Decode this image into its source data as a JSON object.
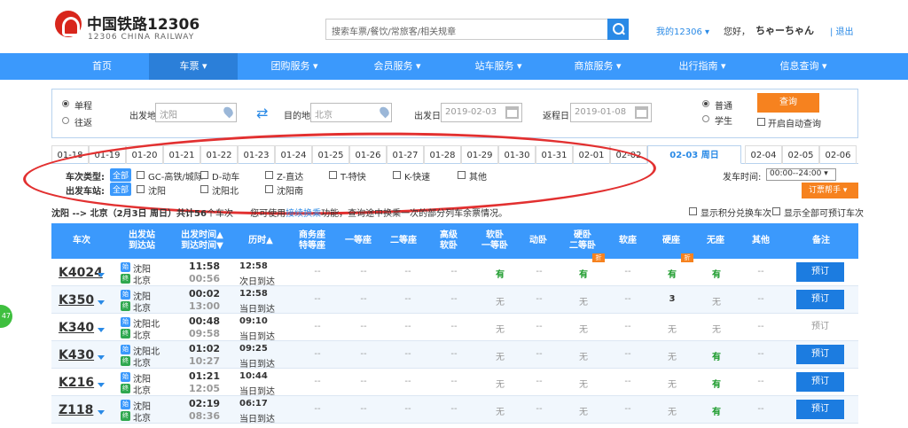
{
  "brand": {
    "cn": "中国铁路12306",
    "en": "12306 CHINA RAILWAY"
  },
  "search": {
    "placeholder": "搜索车票/餐饮/常旅客/相关规章"
  },
  "user": {
    "my": "我的12306 ▾",
    "hello": "您好，",
    "name": "ちゃーちゃん",
    "logout": "| 退出"
  },
  "nav": [
    "首页",
    "车票 ▾",
    "团购服务 ▾",
    "会员服务 ▾",
    "站车服务 ▾",
    "商旅服务 ▾",
    "出行指南 ▾",
    "信息查询 ▾"
  ],
  "query": {
    "oneway": "单程",
    "round": "往返",
    "from_label": "出发地",
    "from_value": "沈阳",
    "to_label": "目的地",
    "to_value": "北京",
    "date_label": "出发日",
    "date_value": "2019-02-03",
    "return_label": "返程日",
    "return_value": "2019-01-08",
    "normal": "普通",
    "student": "学生",
    "query_btn": "查询",
    "auto_query": "开启自动查询"
  },
  "dates": [
    "01-18",
    "01-19",
    "01-20",
    "01-21",
    "01-22",
    "01-23",
    "01-24",
    "01-25",
    "01-26",
    "01-27",
    "01-28",
    "01-29",
    "01-30",
    "01-31",
    "02-01",
    "02-02",
    "02-03 周日",
    "02-04",
    "02-05",
    "02-06"
  ],
  "filters": {
    "type_label": "车次类型:",
    "all": "全部",
    "types": [
      "GC-高铁/城际",
      "D-动车",
      "Z-直达",
      "T-特快",
      "K-快速",
      "其他"
    ],
    "station_label": "出发车站:",
    "stations": [
      "沈阳",
      "沈阳北",
      "沈阳南"
    ],
    "depart_time_label": "发车时间:",
    "depart_time": "00:00--24:00",
    "helper": "订票帮手 ▾"
  },
  "summary": {
    "route": "沈阳 --> 北京（2月3日 周日）共计",
    "count": "56",
    "tail": "个车次",
    "hint_a": "您可使用",
    "hint_link": "接续换乘",
    "hint_b": "功能，查询途中换乘一次的部分列车余票情况。",
    "opt1": "显示积分兑换车次",
    "opt2": "显示全部可预订车次"
  },
  "headers": [
    "车次",
    "出发站\n到达站",
    "出发时间▲\n到达时间▼",
    "历时▲",
    "商务座\n特等座",
    "一等座",
    "二等座",
    "高级\n软卧",
    "软卧\n一等卧",
    "动卧",
    "硬卧\n二等卧",
    "软座",
    "硬座",
    "无座",
    "其他",
    "备注"
  ],
  "trains": [
    {
      "no": "K4024",
      "from": "沈阳",
      "to": "北京",
      "dep": "11:58",
      "arr": "00:56",
      "dur": "12:58",
      "arrday": "次日到达",
      "seats": [
        "--",
        "--",
        "--",
        "--",
        "有",
        "--",
        "有",
        "--",
        "有",
        "有",
        "--"
      ],
      "book": "预订"
    },
    {
      "no": "K350",
      "from": "沈阳",
      "to": "北京",
      "dep": "00:02",
      "arr": "13:00",
      "dur": "12:58",
      "arrday": "当日到达",
      "seats": [
        "--",
        "--",
        "--",
        "--",
        "无",
        "--",
        "无",
        "--",
        "3",
        "无",
        "--"
      ],
      "book": "预订"
    },
    {
      "no": "K340",
      "from": "沈阳北",
      "to": "北京",
      "dep": "00:48",
      "arr": "09:58",
      "dur": "09:10",
      "arrday": "当日到达",
      "seats": [
        "--",
        "--",
        "--",
        "--",
        "无",
        "--",
        "无",
        "--",
        "无",
        "无",
        "--"
      ],
      "book": "预订"
    },
    {
      "no": "K430",
      "from": "沈阳北",
      "to": "北京",
      "dep": "01:02",
      "arr": "10:27",
      "dur": "09:25",
      "arrday": "当日到达",
      "seats": [
        "--",
        "--",
        "--",
        "--",
        "无",
        "--",
        "无",
        "--",
        "无",
        "有",
        "--"
      ],
      "book": "预订"
    },
    {
      "no": "K216",
      "from": "沈阳",
      "to": "北京",
      "dep": "01:21",
      "arr": "12:05",
      "dur": "10:44",
      "arrday": "当日到达",
      "seats": [
        "--",
        "--",
        "--",
        "--",
        "无",
        "--",
        "无",
        "--",
        "无",
        "有",
        "--"
      ],
      "book": "预订"
    },
    {
      "no": "Z118",
      "from": "沈阳",
      "to": "北京",
      "dep": "02:19",
      "arr": "08:36",
      "dur": "06:17",
      "arrday": "当日到达",
      "seats": [
        "--",
        "--",
        "--",
        "--",
        "无",
        "--",
        "无",
        "--",
        "无",
        "有",
        "--"
      ],
      "book": "预订"
    }
  ],
  "zhe": "折",
  "bubble": "47",
  "colors": {
    "nav": "#3b99fc",
    "accent": "#f6821f",
    "available": "#1a9a2a"
  }
}
